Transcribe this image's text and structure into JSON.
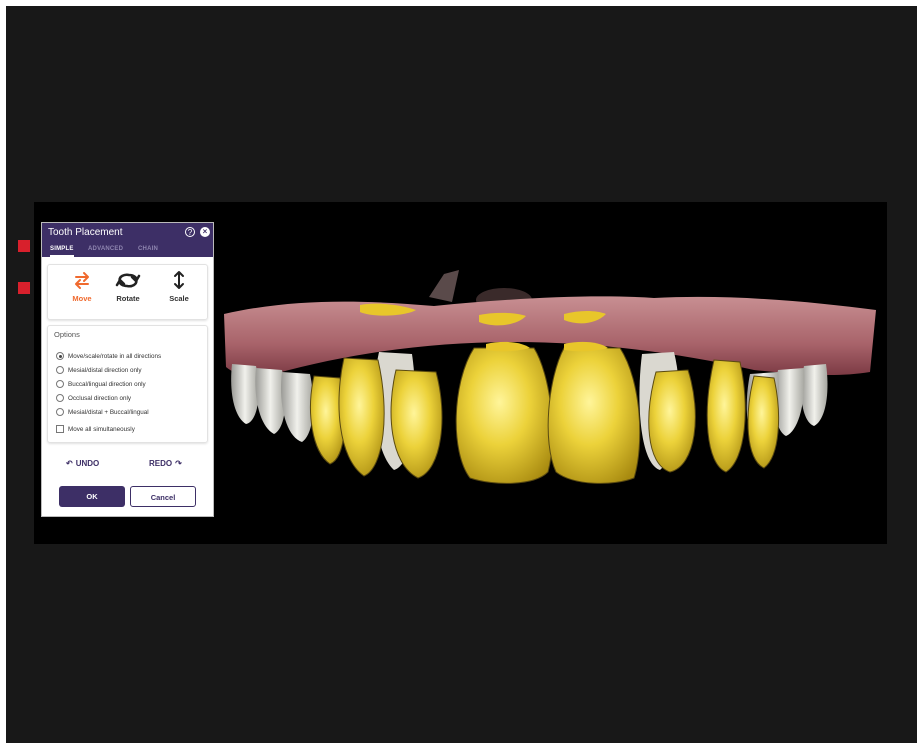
{
  "panel": {
    "title": "Tooth Placement",
    "tabs": [
      {
        "label": "SIMPLE",
        "active": true
      },
      {
        "label": "ADVANCED",
        "active": false
      },
      {
        "label": "CHAIN",
        "active": false
      }
    ],
    "tools": [
      {
        "label": "Move",
        "icon": "move-icon",
        "active": true
      },
      {
        "label": "Rotate",
        "icon": "rotate-icon",
        "active": false
      },
      {
        "label": "Scale",
        "icon": "scale-icon",
        "active": false
      }
    ],
    "options_title": "Options",
    "options": [
      {
        "label": "Move/scale/rotate in all directions",
        "checked": true
      },
      {
        "label": "Mesial/distal direction only",
        "checked": false
      },
      {
        "label": "Buccal/lingual direction only",
        "checked": false
      },
      {
        "label": "Occlusal direction only",
        "checked": false
      },
      {
        "label": "Mesial/distal + Buccal/lingual",
        "checked": false
      }
    ],
    "move_all_label": "Move all simultaneously",
    "move_all_checked": false,
    "undo_label": "UNDO",
    "redo_label": "REDO",
    "ok_label": "OK",
    "cancel_label": "Cancel"
  },
  "colors": {
    "accent": "#3d2f66",
    "active_tool": "#f06a2e",
    "marker": "#d8202c",
    "tooth_highlight": "#e8c62a",
    "gum": "#b27074"
  }
}
